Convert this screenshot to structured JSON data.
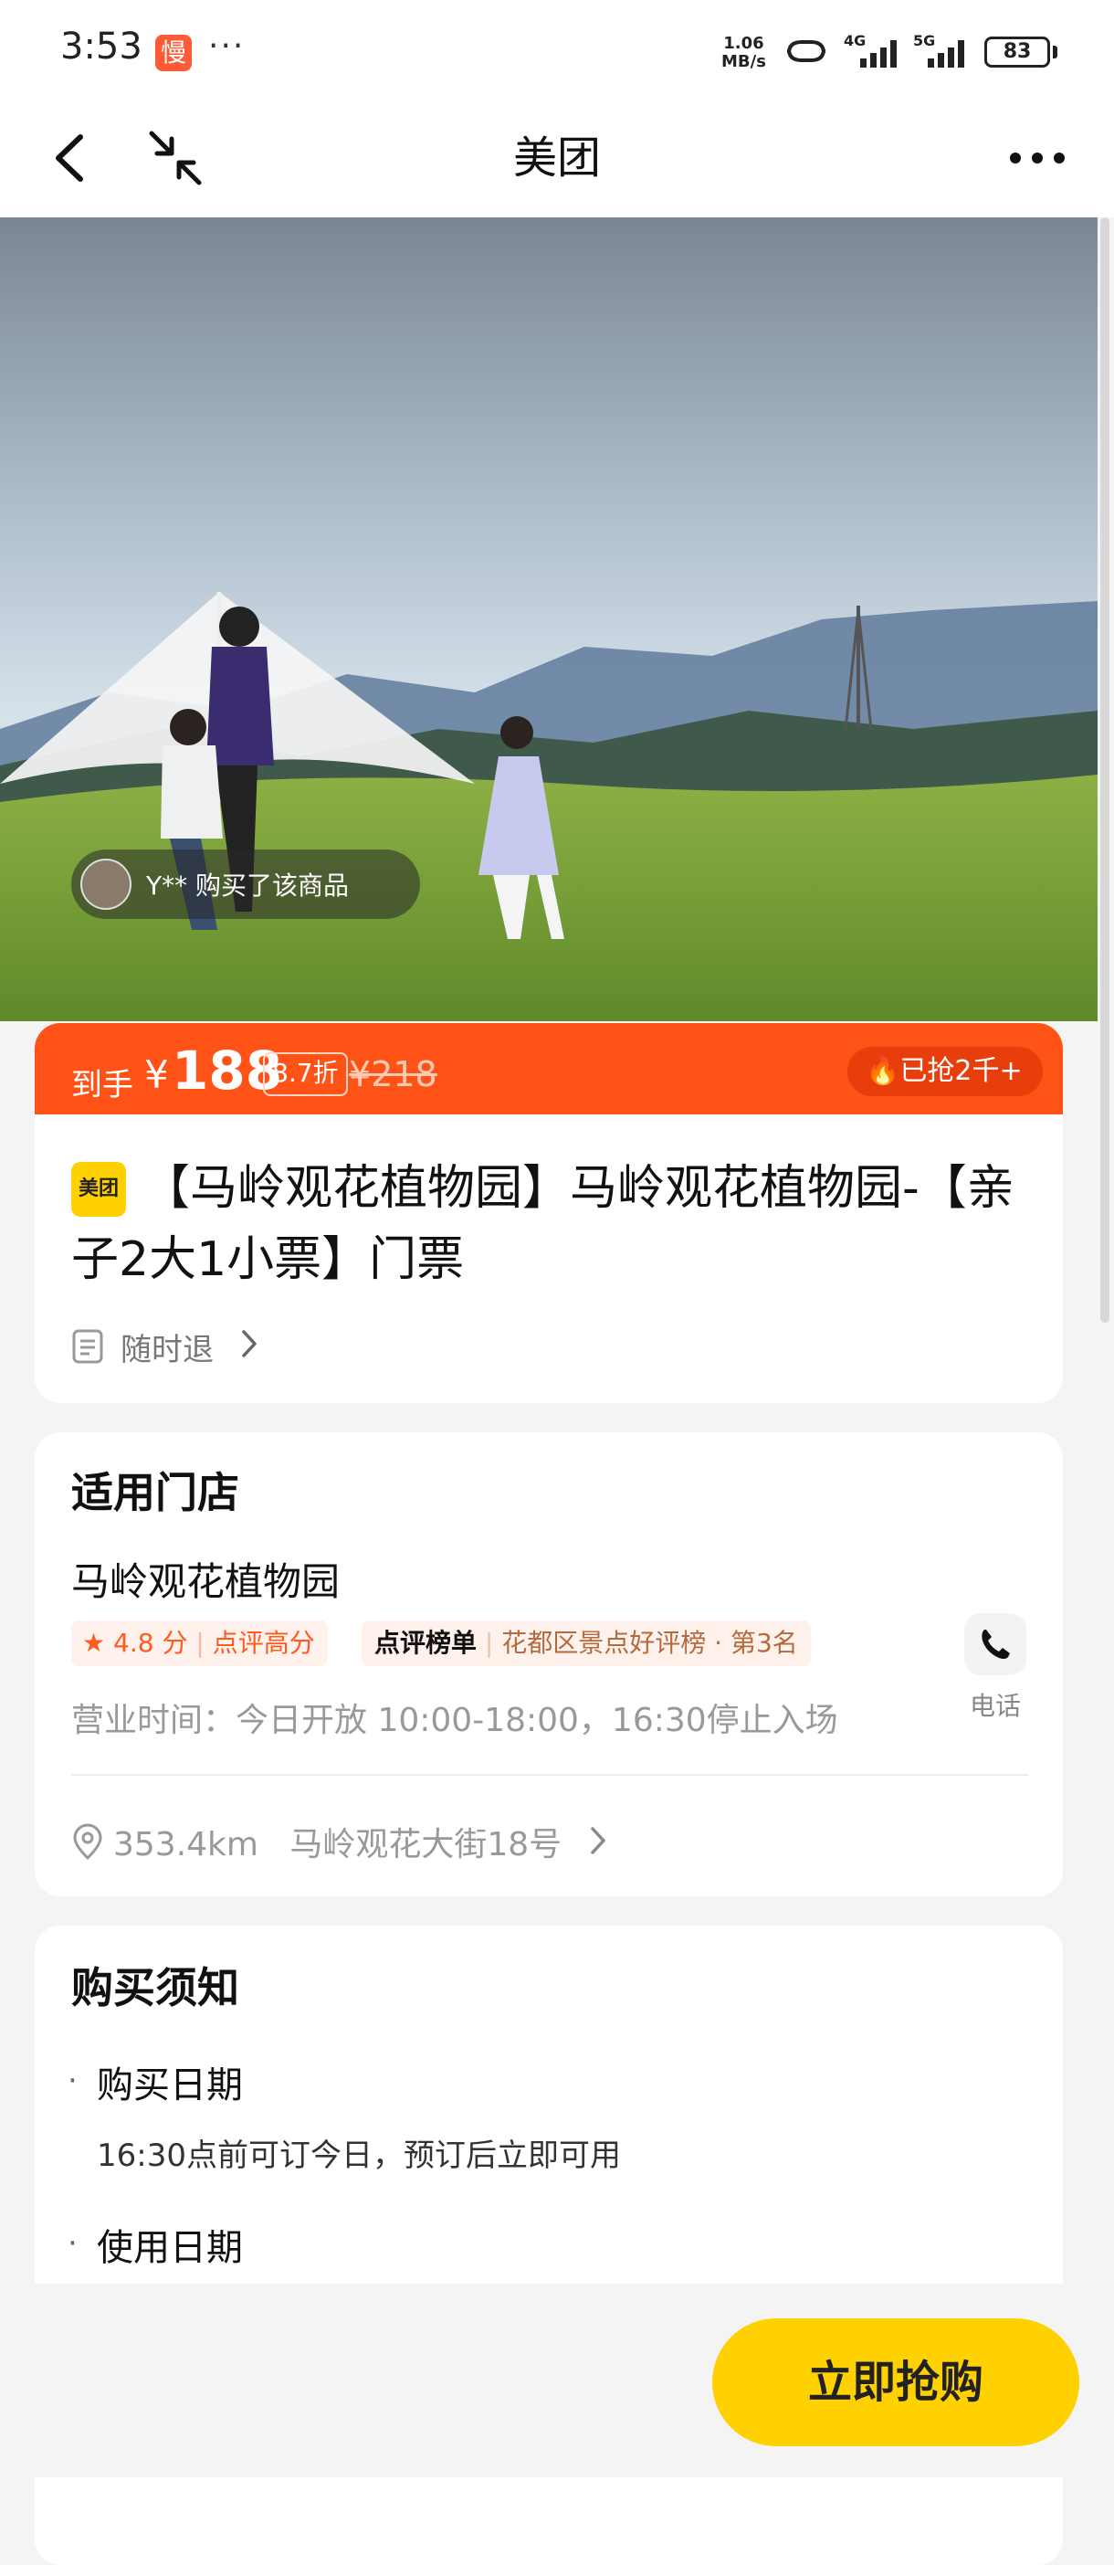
{
  "status_bar": {
    "time": "3:53",
    "app_badge": "慢",
    "more_dots": "···",
    "network_speed": "1.06\nMB/s",
    "signal_1": "4G",
    "signal_2": "5G",
    "battery": "83"
  },
  "nav": {
    "title": "美团",
    "icons": [
      "back-icon",
      "shrink-icon",
      "more-icon"
    ]
  },
  "hero": {
    "buyer_text": "Y** 购买了该商品"
  },
  "price_banner": {
    "prefix": "到手",
    "currency": "¥",
    "price": "188",
    "discount": "8.7折",
    "original_price": "¥218",
    "sold": "已抢2千+"
  },
  "product": {
    "logo": "美团",
    "title": "【马岭观花植物园】马岭观花植物园-【亲子2大1小票】门票",
    "refund": "随时退"
  },
  "store": {
    "section_title": "适用门店",
    "name": "马岭观花植物园",
    "rating": "4.8 分",
    "rating_note": "点评高分",
    "rank_brand": "点评榜单",
    "rank_text": "花都区景点好评榜 · 第3名",
    "phone_label": "电话",
    "hours": "营业时间：今日开放 10:00-18:00，16:30停止入场",
    "distance": "353.4km",
    "address": "马岭观花大街18号"
  },
  "notice": {
    "title": "购买须知",
    "items": [
      {
        "label": "购买日期",
        "detail": "16:30点前可订今日，预订后立即可用"
      },
      {
        "label": "使用日期",
        "detail": ""
      }
    ]
  },
  "bottom": {
    "buy_label": "立即抢购"
  },
  "colors": {
    "brand_yellow": "#ffd100",
    "price_orange": "#ff5216"
  }
}
